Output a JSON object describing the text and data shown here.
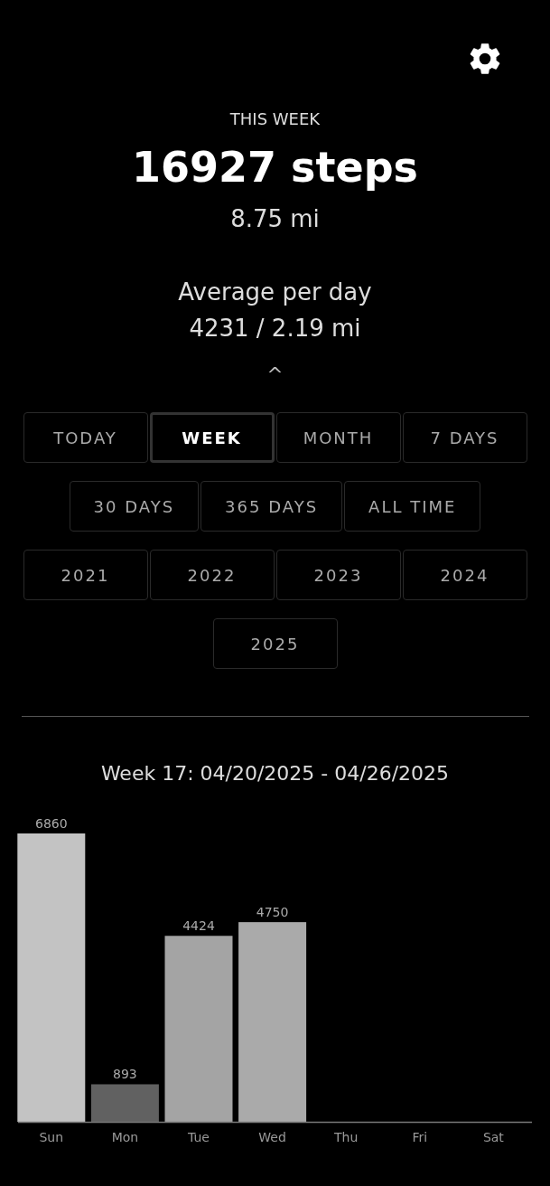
{
  "header": {
    "period_label": "THIS WEEK",
    "steps": "16927 steps",
    "distance": "8.75 mi",
    "average_label": "Average per day",
    "average_value": "4231 / 2.19 mi",
    "collapse": "^"
  },
  "ranges": [
    {
      "label": "TODAY",
      "selected": false
    },
    {
      "label": "WEEK",
      "selected": true
    },
    {
      "label": "MONTH",
      "selected": false
    },
    {
      "label": "7 DAYS",
      "selected": false
    },
    {
      "label": "30 DAYS",
      "selected": false
    },
    {
      "label": "365 DAYS",
      "selected": false
    },
    {
      "label": "ALL TIME",
      "selected": false
    },
    {
      "label": "2021",
      "selected": false
    },
    {
      "label": "2022",
      "selected": false
    },
    {
      "label": "2023",
      "selected": false
    },
    {
      "label": "2024",
      "selected": false
    },
    {
      "label": "2025",
      "selected": false
    }
  ],
  "chart": {
    "title": "Week 17: 04/20/2025 - 04/26/2025",
    "chart_data": {
      "type": "bar",
      "categories": [
        "Sun",
        "Mon",
        "Tue",
        "Wed",
        "Thu",
        "Fri",
        "Sat"
      ],
      "values": [
        6860,
        893,
        4424,
        4750,
        null,
        null,
        null
      ],
      "data_labels": true
    }
  }
}
